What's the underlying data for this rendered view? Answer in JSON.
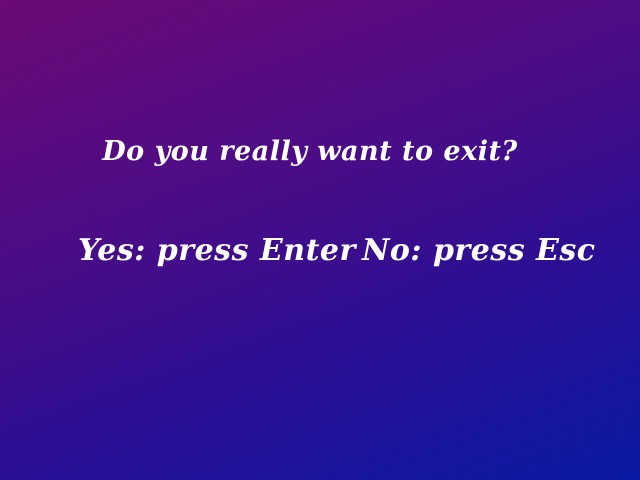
{
  "dialog": {
    "question": "Do you really want to exit?",
    "yes_label": "Yes: press Enter",
    "no_label": "No: press Esc"
  },
  "colors": {
    "background_gradient_start": "#6c0a76",
    "background_gradient_end": "#0a1aa4",
    "text": "#ffffff"
  }
}
